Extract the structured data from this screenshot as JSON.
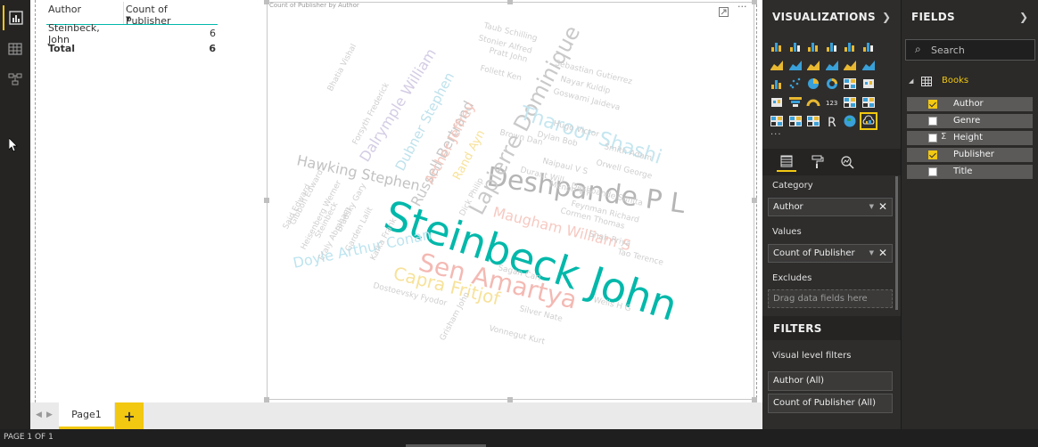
{
  "table_visual": {
    "headers": [
      "Author",
      "Count of Publisher"
    ],
    "rows": [
      {
        "author": "Steinbeck, John",
        "count": "6"
      }
    ],
    "total": {
      "label": "Total",
      "count": "6"
    }
  },
  "wordcloud": {
    "title": "Count of Publisher by Author",
    "words": [
      {
        "text": "Steinbeck John",
        "color": "#01b8aa"
      },
      {
        "text": "Deshpande P L",
        "color": "#b5b5b5"
      },
      {
        "text": "Sen Amartya",
        "color": "#f4b9b3"
      },
      {
        "text": "Lapierre Dominique",
        "color": "#c9c9c9"
      },
      {
        "text": "Tharoor Shashi",
        "color": "#c5e6f0"
      },
      {
        "text": "Capra Fritjof",
        "color": "#f7e29a"
      },
      {
        "text": "Doyle Arthur Conan",
        "color": "#bde4ef"
      },
      {
        "text": "Hawking Stephen",
        "color": "#c2c2c2"
      },
      {
        "text": "Maugham William S",
        "color": "#f6c9c2"
      },
      {
        "text": "Dalrymple William",
        "color": "#d4cce4"
      },
      {
        "text": "Russell Bertrand",
        "color": "#c8c8c8"
      },
      {
        "text": "Dubner Stephen",
        "color": "#bfe2ec"
      },
      {
        "text": "Archer Jeffrey",
        "color": "#f3c6bd"
      },
      {
        "text": "Rand Ayn",
        "color": "#f7e29a"
      },
      {
        "text": "Durant Will",
        "color": "#cfcfcf"
      },
      {
        "text": "Orwell George",
        "color": "#cfcfcf"
      },
      {
        "text": "Smith Adam",
        "color": "#cfcfcf"
      },
      {
        "text": "Naipaul V S",
        "color": "#cfcfcf"
      },
      {
        "text": "Tao Terence",
        "color": "#cfcfcf"
      },
      {
        "text": "Wells H G",
        "color": "#cfcfcf"
      },
      {
        "text": "Silver Nate",
        "color": "#cfcfcf"
      },
      {
        "text": "Dylan Bob",
        "color": "#cfcfcf"
      },
      {
        "text": "Brown Dan",
        "color": "#cfcfcf"
      },
      {
        "text": "Hugo Victor",
        "color": "#cfcfcf"
      },
      {
        "text": "Dostoevsky Fyodor",
        "color": "#cfcfcf"
      },
      {
        "text": "Shah Priya",
        "color": "#cfcfcf"
      },
      {
        "text": "Gibbon Edward",
        "color": "#cfcfcf"
      },
      {
        "text": "Kafka Frank",
        "color": "#cfcfcf"
      },
      {
        "text": "Sebastian Gutierrez",
        "color": "#cfcfcf"
      },
      {
        "text": "Nayar Kuldip",
        "color": "#cfcfcf"
      },
      {
        "text": "Goswami Jaideva",
        "color": "#cfcfcf"
      },
      {
        "text": "Taub Schilling",
        "color": "#cfcfcf"
      },
      {
        "text": "Stonier Alfred",
        "color": "#cfcfcf"
      },
      {
        "text": "Pratt John",
        "color": "#cfcfcf"
      },
      {
        "text": "Follett Ken",
        "color": "#cfcfcf"
      },
      {
        "text": "Feynman Richard",
        "color": "#cfcfcf"
      },
      {
        "text": "Cormen Thomas",
        "color": "#cfcfcf"
      },
      {
        "text": "Deshpande Sunita",
        "color": "#cfcfcf"
      },
      {
        "text": "Menon V P",
        "color": "#cfcfcf"
      },
      {
        "text": "Dick Philip",
        "color": "#cfcfcf"
      },
      {
        "text": "Sagan Carl",
        "color": "#cfcfcf"
      },
      {
        "text": "Eraly Abraham",
        "color": "#cfcfcf"
      },
      {
        "text": "Bradsky Gary",
        "color": "#cfcfcf"
      },
      {
        "text": "Heisenberg Werner",
        "color": "#cfcfcf"
      },
      {
        "text": "Garden Lalit",
        "color": "#cfcfcf"
      },
      {
        "text": "Said Edward",
        "color": "#cfcfcf"
      },
      {
        "text": "Steinbeck",
        "color": "#cfcfcf"
      },
      {
        "text": "Bhatia Vishal",
        "color": "#cfcfcf"
      },
      {
        "text": "Forsyth Frederick",
        "color": "#cfcfcf"
      },
      {
        "text": "Vonnegut Kurt",
        "color": "#cfcfcf"
      },
      {
        "text": "Grisham John",
        "color": "#cfcfcf"
      }
    ]
  },
  "pages": {
    "tabs": [
      "Page1"
    ],
    "add_label": "+",
    "status": "PAGE 1 OF 1"
  },
  "visualizations": {
    "title": "VISUALIZATIONS",
    "more": "...",
    "category_label": "Category",
    "category_value": "Author",
    "values_label": "Values",
    "values_value": "Count of Publisher",
    "excludes_label": "Excludes",
    "excludes_placeholder": "Drag data fields here",
    "filters_title": "FILTERS",
    "visual_level_filters": "Visual level filters",
    "filter_items": [
      "Author (All)",
      "Count of Publisher (All)"
    ]
  },
  "fields": {
    "title": "FIELDS",
    "search_placeholder": "Search",
    "table_name": "Books",
    "items": [
      {
        "label": "Author",
        "checked": true,
        "sigma": ""
      },
      {
        "label": "Genre",
        "checked": false,
        "sigma": ""
      },
      {
        "label": "Height",
        "checked": false,
        "sigma": "Σ"
      },
      {
        "label": "Publisher",
        "checked": true,
        "sigma": ""
      },
      {
        "label": "Title",
        "checked": false,
        "sigma": ""
      }
    ]
  },
  "colors": {
    "accent": "#f2c811",
    "teal": "#01b8aa",
    "pane_dark": "#2e2d2c",
    "nav_dark": "#252423"
  }
}
